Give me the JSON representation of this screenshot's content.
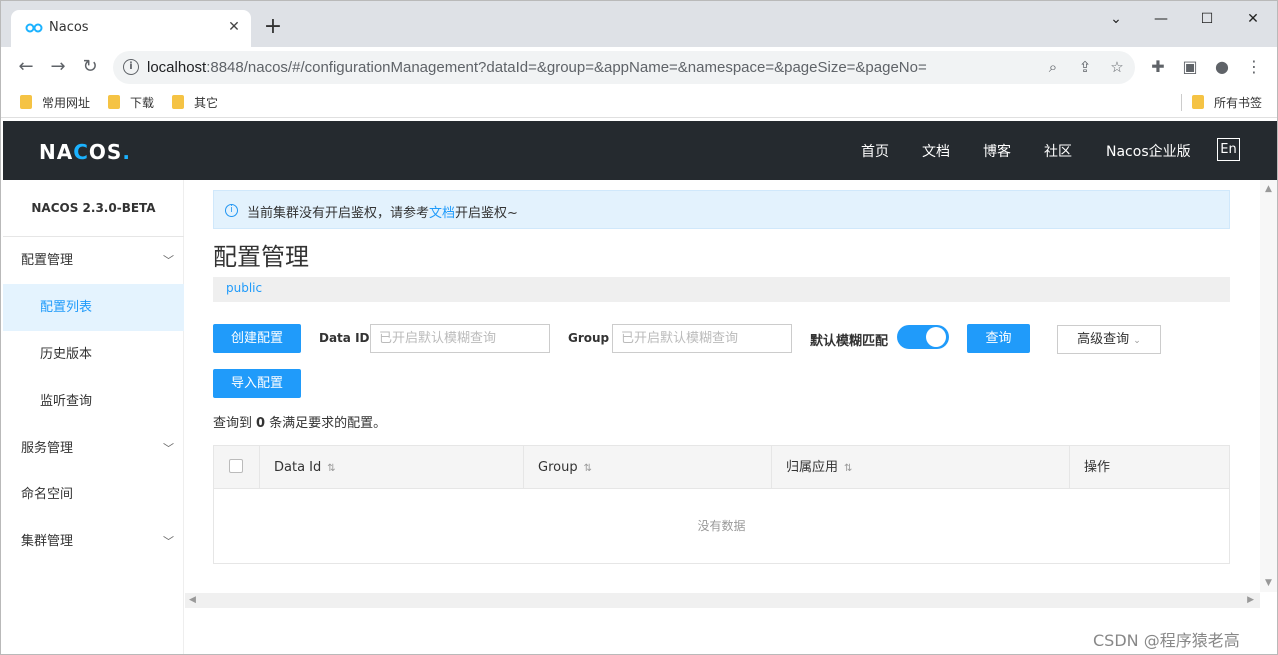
{
  "browser": {
    "tab_title": "Nacos",
    "url_host": "localhost",
    "url_rest": ":8848/nacos/#/configurationManagement?dataId=&group=&appName=&namespace=&pageSize=&pageNo=",
    "bookmarks": [
      "常用网址",
      "下载",
      "其它"
    ],
    "bookmarks_right": "所有书签"
  },
  "header": {
    "logo": "NACOS.",
    "nav": [
      "首页",
      "文档",
      "博客",
      "社区",
      "Nacos企业版"
    ],
    "lang": "En"
  },
  "sidebar": {
    "version": "NACOS 2.3.0-BETA",
    "items": [
      {
        "label": "配置管理",
        "expandable": true
      },
      {
        "label": "配置列表",
        "active": true
      },
      {
        "label": "历史版本"
      },
      {
        "label": "监听查询"
      },
      {
        "label": "服务管理",
        "expandable": true
      },
      {
        "label": "命名空间"
      },
      {
        "label": "集群管理",
        "expandable": true
      }
    ]
  },
  "main": {
    "notice_prefix": "当前集群没有开启鉴权，请参考",
    "notice_link": "文档",
    "notice_suffix": "开启鉴权~",
    "title": "配置管理",
    "namespace": "public",
    "create_button": "创建配置",
    "import_button": "导入配置",
    "data_id_label": "Data ID",
    "data_id_placeholder": "已开启默认模糊查询",
    "group_label": "Group",
    "group_placeholder": "已开启默认模糊查询",
    "fuzzy_label": "默认模糊匹配",
    "fuzzy_enabled": true,
    "search_button": "查询",
    "advanced_button": "高级查询",
    "result_prefix": "查询到",
    "result_count": "0",
    "result_suffix": "条满足要求的配置。",
    "table_headers": [
      "Data Id",
      "Group",
      "归属应用",
      "操作"
    ],
    "empty_text": "没有数据"
  },
  "watermark": "CSDN @程序猿老高",
  "colors": {
    "accent": "#209bfa",
    "header_bg": "#252a2f",
    "notice_bg": "#e3f2fd"
  }
}
